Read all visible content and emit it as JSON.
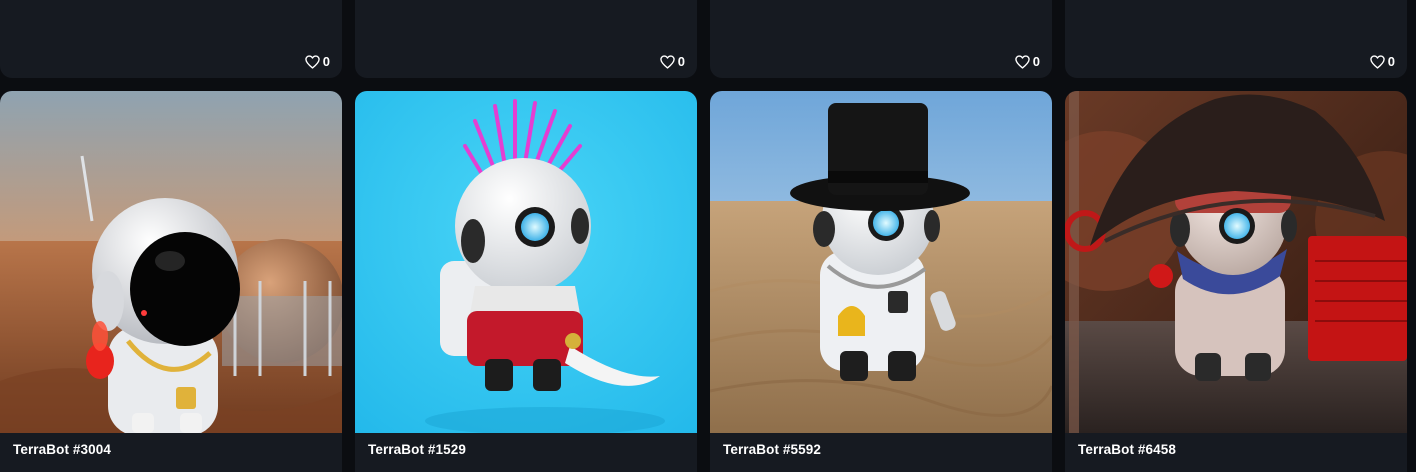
{
  "top_row": [
    {
      "likes": "0",
      "icon": "heart-icon"
    },
    {
      "likes": "0",
      "icon": "heart-icon"
    },
    {
      "likes": "0",
      "icon": "heart-icon"
    },
    {
      "likes": "0",
      "icon": "heart-icon"
    }
  ],
  "nfts": [
    {
      "name": "TerraBot #3004",
      "scene": "mars-astronaut"
    },
    {
      "name": "TerraBot #1529",
      "scene": "mohawk-sword"
    },
    {
      "name": "TerraBot #5592",
      "scene": "top-hat-desert"
    },
    {
      "name": "TerraBot #6458",
      "scene": "pirate-hat"
    }
  ],
  "colors": {
    "page_bg": "#0b0d11",
    "card_bg": "#161a21",
    "text": "#ffffff"
  }
}
